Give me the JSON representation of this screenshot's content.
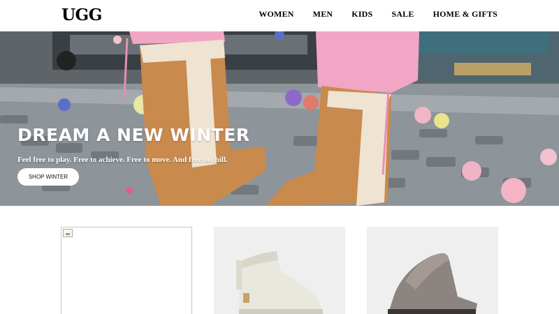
{
  "header": {
    "logo": "UGG",
    "nav": [
      "WOMEN",
      "MEN",
      "KIDS",
      "SALE",
      "HOME & GIFTS"
    ]
  },
  "hero": {
    "title": "DREAM A NEW WINTER",
    "subtitle": "Feel free to play. Free to achieve. Free to move. And free to chill.",
    "cta": "SHOP WINTER"
  },
  "products": [
    {
      "image": "broken-image-icon"
    },
    {
      "image": "white-mini-boot"
    },
    {
      "image": "grey-slipper"
    }
  ],
  "colors": {
    "boot_chestnut": "#c98a4e",
    "sheepskin": "#efe3d2",
    "pink_pants": "#f2a6c6",
    "cobblestone": "#7b8086"
  }
}
